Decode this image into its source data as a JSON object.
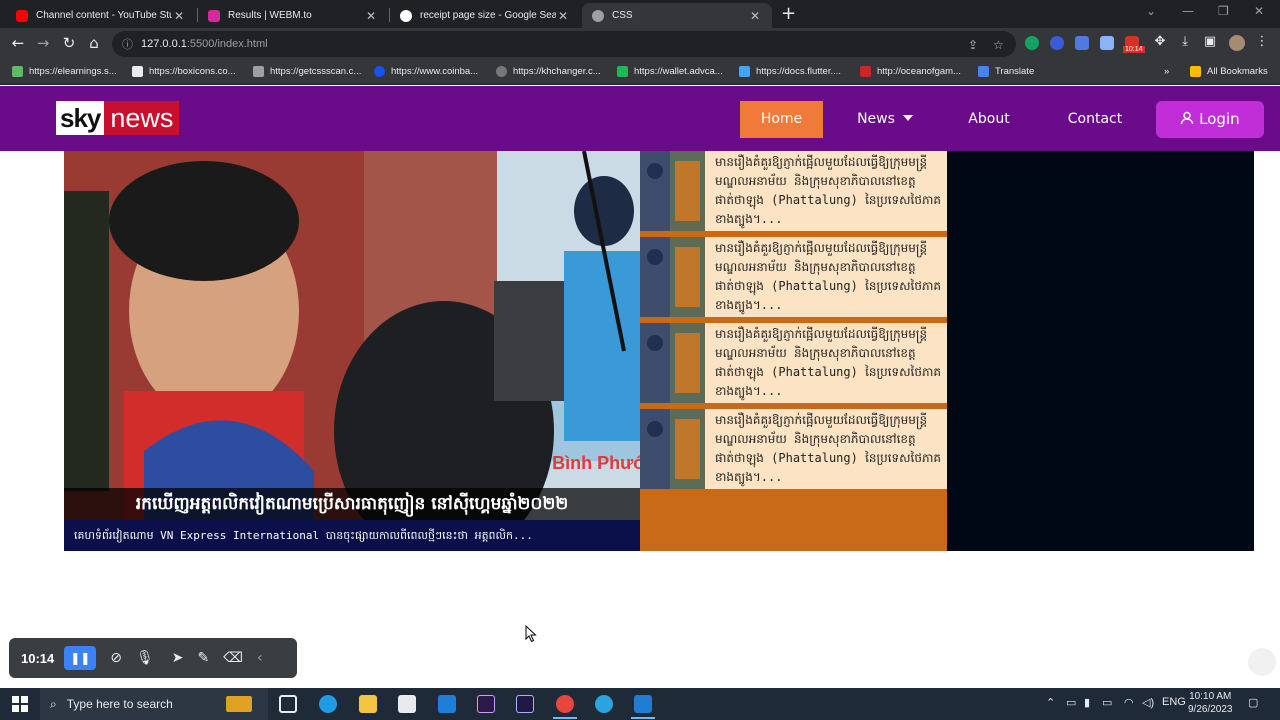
{
  "browser": {
    "tabs": [
      {
        "title": "Channel content - YouTube Studio",
        "color": "#ff0000"
      },
      {
        "title": "Results | WEBM.to",
        "color": "#d62a9b"
      },
      {
        "title": "receipt page size - Google Search",
        "color": "#4285f4"
      },
      {
        "title": "CSS",
        "color": "#9aa0a6"
      }
    ],
    "url_host": "127.0.0.1",
    "url_rest": ":5500/index.html",
    "ext_badge": "10:14",
    "bookmarks": [
      "https://elearnings.s...",
      "https://boxicons.co...",
      "https://getcssscan.c...",
      "https://www.coinba...",
      "https://khchanger.c...",
      "https://wallet.advca...",
      "https://docs.flutter....",
      "http://oceanofgam...",
      "Translate"
    ],
    "all_bookmarks": "All Bookmarks"
  },
  "site": {
    "logo_sky": "sky",
    "logo_news": "news",
    "menu": {
      "home": "Home",
      "news": "News",
      "about": "About",
      "contact": "Contact",
      "login": "Login"
    },
    "colors": {
      "header": "#6a0b8a",
      "home": "#f07a3a",
      "login": "#c12ed8",
      "side": "#fbe3c3"
    }
  },
  "hero": {
    "title": "រកឃើញអត្តពលិកវៀតណាមប្រើសារធាតុញៀន នៅស៊ីហ្គេមឆ្នាំ២០២២",
    "subtitle": "គេហទំព័រវៀតណាម VN Express International បានចុះផ្សាយកាលពីពេលថ្មីៗនេះថា អត្តពលិក...",
    "watermark": "Bình Phước"
  },
  "side_items": [
    {
      "text": "មានរឿងគំគួរឱ្យភ្ញាក់ផ្អើលមួយដែលធ្វើឱ្យក្រុមមន្ត្រីមណ្ឌលអនាម័យ និងក្រុមសុខាភិបាលនៅខេត្តផាត់ថាឡុង (Phattalung) នៃប្រទេសថៃភាគខាងត្បូង។..."
    },
    {
      "text": "មានរឿងគំគួរឱ្យភ្ញាក់ផ្អើលមួយដែលធ្វើឱ្យក្រុមមន្ត្រីមណ្ឌលអនាម័យ និងក្រុមសុខាភិបាលនៅខេត្តផាត់ថាឡុង (Phattalung) នៃប្រទេសថៃភាគខាងត្បូង។..."
    },
    {
      "text": "មានរឿងគំគួរឱ្យភ្ញាក់ផ្អើលមួយដែលធ្វើឱ្យក្រុមមន្ត្រីមណ្ឌលអនាម័យ និងក្រុមសុខាភិបាលនៅខេត្តផាត់ថាឡុង (Phattalung) នៃប្រទេសថៃភាគខាងត្បូង។..."
    },
    {
      "text": "មានរឿងគំគួរឱ្យភ្ញាក់ផ្អើលមួយដែលធ្វើឱ្យក្រុមមន្ត្រីមណ្ឌលអនាម័យ និងក្រុមសុខាភិបាលនៅខេត្តផាត់ថាឡុង (Phattalung) នៃប្រទេសថៃភាគខាងត្បូង។..."
    }
  ],
  "recorder": {
    "time": "10:14"
  },
  "taskbar": {
    "search_placeholder": "Type here to search",
    "lang": "ENG",
    "time": "10:10 AM",
    "date": "9/26/2023"
  }
}
